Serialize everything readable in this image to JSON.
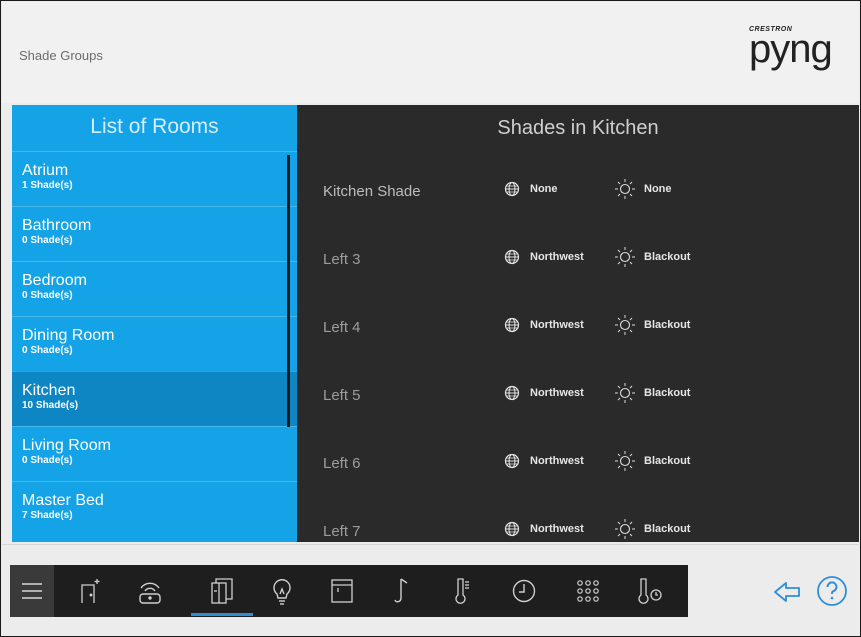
{
  "header": {
    "title": "Shade Groups",
    "logo_small": "CRESTRON",
    "logo_big": "pyng"
  },
  "rooms": {
    "heading": "List of Rooms",
    "items": [
      {
        "name": "Atrium",
        "count": "1 Shade(s)"
      },
      {
        "name": "Bathroom",
        "count": "0 Shade(s)"
      },
      {
        "name": "Bedroom",
        "count": "0 Shade(s)"
      },
      {
        "name": "Dining Room",
        "count": "0 Shade(s)"
      },
      {
        "name": "Kitchen",
        "count": "10 Shade(s)",
        "selected": true
      },
      {
        "name": "Living Room",
        "count": "0 Shade(s)"
      },
      {
        "name": "Master Bed",
        "count": "7 Shade(s)"
      }
    ]
  },
  "shades": {
    "heading": "Shades in Kitchen",
    "rows": [
      {
        "name": "Kitchen Shade",
        "orientation": "None",
        "mode": "None"
      },
      {
        "name": "Left 3",
        "orientation": "Northwest",
        "mode": "Blackout"
      },
      {
        "name": "Left 4",
        "orientation": "Northwest",
        "mode": "Blackout"
      },
      {
        "name": "Left 5",
        "orientation": "Northwest",
        "mode": "Blackout"
      },
      {
        "name": "Left 6",
        "orientation": "Northwest",
        "mode": "Blackout"
      },
      {
        "name": "Left 7",
        "orientation": "Northwest",
        "mode": "Blackout"
      }
    ]
  },
  "navbar": {
    "items": [
      {
        "icon": "menu-icon"
      },
      {
        "icon": "door-icon"
      },
      {
        "icon": "remote-icon"
      },
      {
        "icon": "shades-icon",
        "active": true
      },
      {
        "icon": "lightbulb-icon"
      },
      {
        "icon": "window-icon"
      },
      {
        "icon": "music-note-icon"
      },
      {
        "icon": "thermometer-icon"
      },
      {
        "icon": "clock-icon"
      },
      {
        "icon": "keypad-icon"
      },
      {
        "icon": "temperature-sensor-icon"
      }
    ]
  },
  "actions": {
    "back_icon": "back-arrow-icon",
    "help_icon": "help-icon",
    "accent_color": "#2e8fd6"
  },
  "colors": {
    "rooms_panel": "#14a3e6",
    "rooms_selected": "#0e86c4",
    "shades_panel": "#2a2a2a",
    "header_bg": "#f1f1f1"
  }
}
